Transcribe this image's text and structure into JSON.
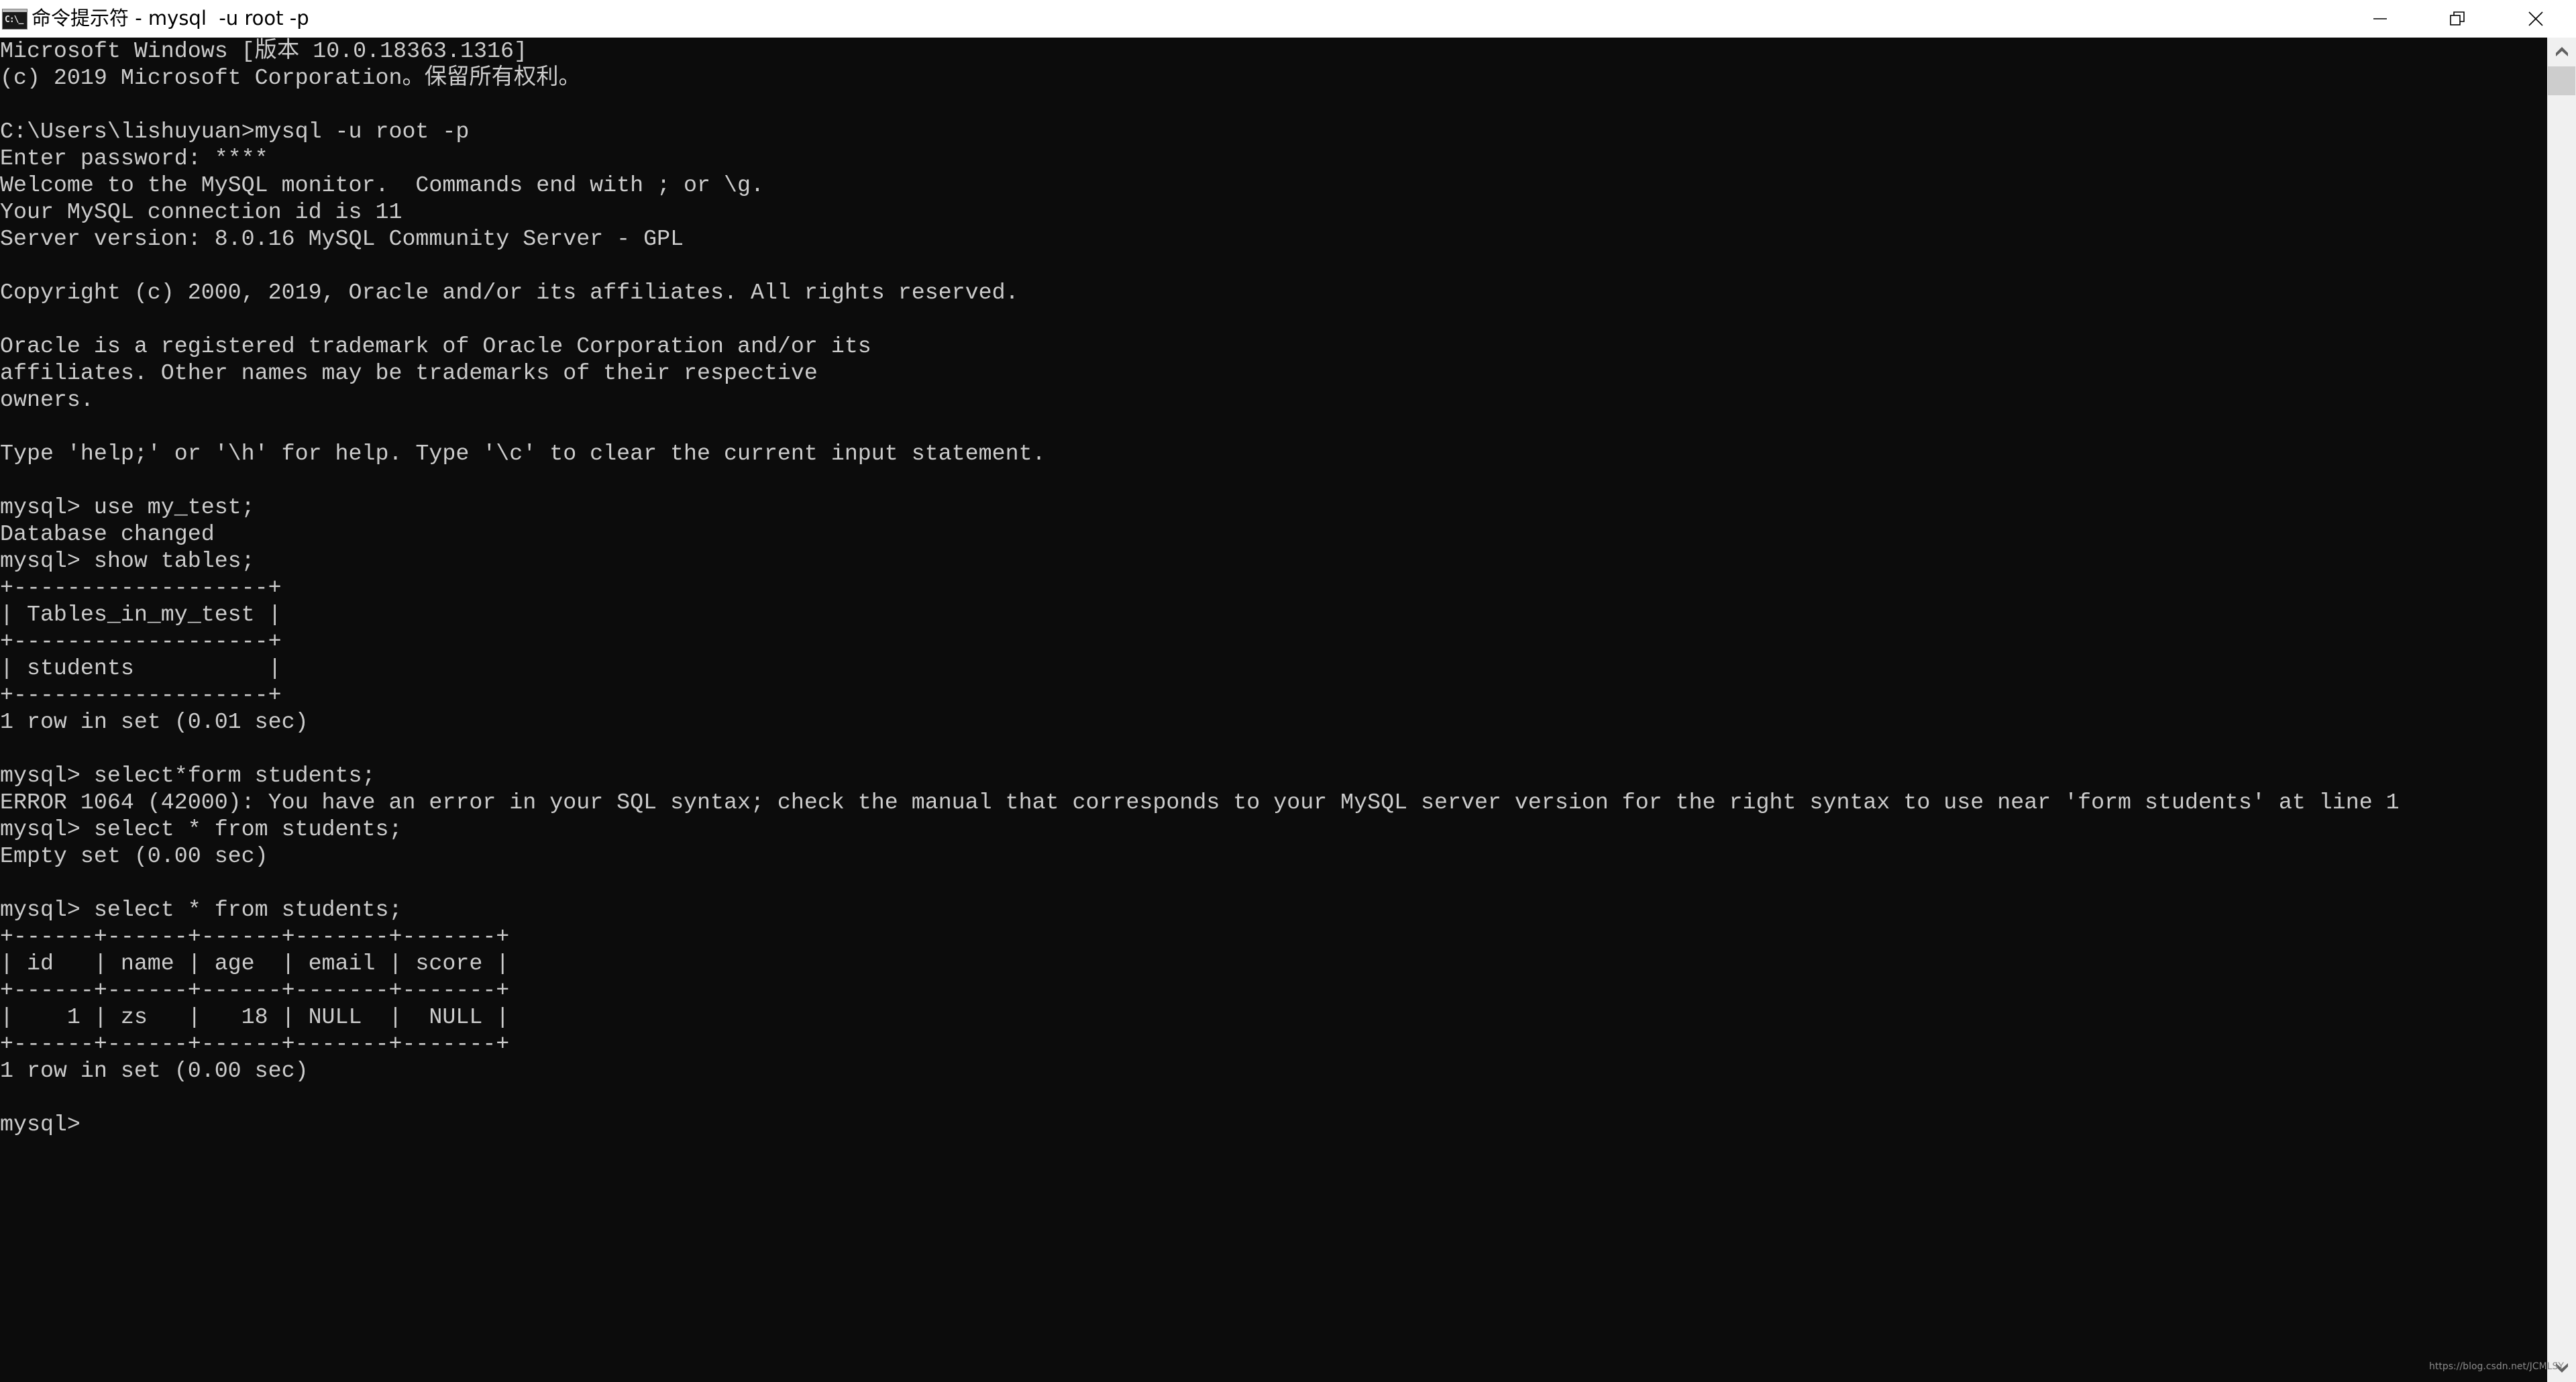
{
  "window": {
    "title": "命令提示符 - mysql  -u root -p",
    "icon": "cmd-icon",
    "icon_glyph": "C:\\_",
    "controls": {
      "minimize": "minimize-icon",
      "restore": "restore-icon",
      "close": "close-icon"
    }
  },
  "colors": {
    "console_bg": "#0c0c0c",
    "console_fg": "#cccccc",
    "titlebar_bg": "#ffffff",
    "scrollbar_track": "#f0f0f0",
    "scrollbar_thumb": "#cdcdcd",
    "scrollbar_arrow": "#606060"
  },
  "console": {
    "lines": [
      "Microsoft Windows [版本 10.0.18363.1316]",
      "(c) 2019 Microsoft Corporation。保留所有权利。",
      "",
      "C:\\Users\\lishuyuan>mysql -u root -p",
      "Enter password: ****",
      "Welcome to the MySQL monitor.  Commands end with ; or \\g.",
      "Your MySQL connection id is 11",
      "Server version: 8.0.16 MySQL Community Server - GPL",
      "",
      "Copyright (c) 2000, 2019, Oracle and/or its affiliates. All rights reserved.",
      "",
      "Oracle is a registered trademark of Oracle Corporation and/or its",
      "affiliates. Other names may be trademarks of their respective",
      "owners.",
      "",
      "Type 'help;' or '\\h' for help. Type '\\c' to clear the current input statement.",
      "",
      "mysql> use my_test;",
      "Database changed",
      "mysql> show tables;",
      "+-------------------+",
      "| Tables_in_my_test |",
      "+-------------------+",
      "| students          |",
      "+-------------------+",
      "1 row in set (0.01 sec)",
      "",
      "mysql> select*form students;",
      "ERROR 1064 (42000): You have an error in your SQL syntax; check the manual that corresponds to your MySQL server version for the right syntax to use near 'form students' at line 1",
      "mysql> select * from students;",
      "Empty set (0.00 sec)",
      "",
      "mysql> select * from students;",
      "+------+------+------+-------+-------+",
      "| id   | name | age  | email | score |",
      "+------+------+------+-------+-------+",
      "|    1 | zs   |   18 | NULL  |  NULL |",
      "+------+------+------+-------+-------+",
      "1 row in set (0.00 sec)",
      "",
      "mysql>"
    ]
  },
  "scrollbar": {
    "up_icon": "scroll-up-arrow-icon",
    "down_icon": "scroll-down-arrow-icon"
  },
  "watermark": "https://blog.csdn.net/JCMLSY"
}
